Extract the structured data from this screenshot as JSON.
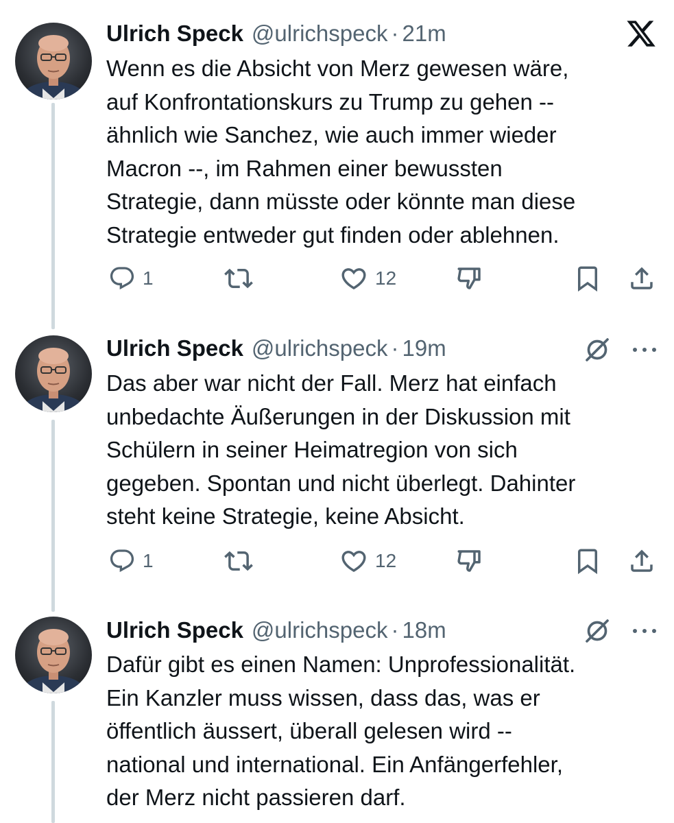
{
  "tweets": [
    {
      "name": "Ulrich Speck",
      "handle": "@ulrichspeck",
      "separator": "·",
      "time": "21m",
      "text": "Wenn es die Absicht von Merz gewesen wäre,\nauf Konfrontationskurs zu Trump zu gehen --\nähnlich wie Sanchez, wie auch immer wieder\nMacron --, im Rahmen einer bewussten\nStrategie, dann müsste oder könnte man diese\nStrategie entweder gut finden oder ablehnen.",
      "replies": "1",
      "likes": "12",
      "top_icon": "x-logo-icon"
    },
    {
      "name": "Ulrich Speck",
      "handle": "@ulrichspeck",
      "separator": "·",
      "time": "19m",
      "text": "Das aber war nicht der Fall. Merz hat einfach\nunbedachte Äußerungen in der Diskussion mit\nSchülern in seiner Heimatregion von sich\ngegeben. Spontan und nicht überlegt. Dahinter\nsteht keine Strategie, keine Absicht.",
      "replies": "1",
      "likes": "12",
      "top_icon": "grok-icon"
    },
    {
      "name": "Ulrich Speck",
      "handle": "@ulrichspeck",
      "separator": "·",
      "time": "18m",
      "text": "Dafür gibt es einen Namen: Unprofessionalität.\nEin Kanzler muss wissen, dass das, was er\nöffentlich äussert, überall gelesen wird --\nnational und international. Ein Anfängerfehler,\nder Merz nicht passieren darf.",
      "top_icon": "grok-icon"
    }
  ],
  "icons": {
    "reply": "reply-icon",
    "retweet": "retweet-icon",
    "like": "like-icon",
    "dislike": "dislike-icon",
    "bookmark": "bookmark-icon",
    "share": "share-icon",
    "more": "more-icon"
  },
  "colors": {
    "text": "#0f1419",
    "secondary": "#536471",
    "thread_line": "#cfd9de",
    "background": "#ffffff"
  }
}
